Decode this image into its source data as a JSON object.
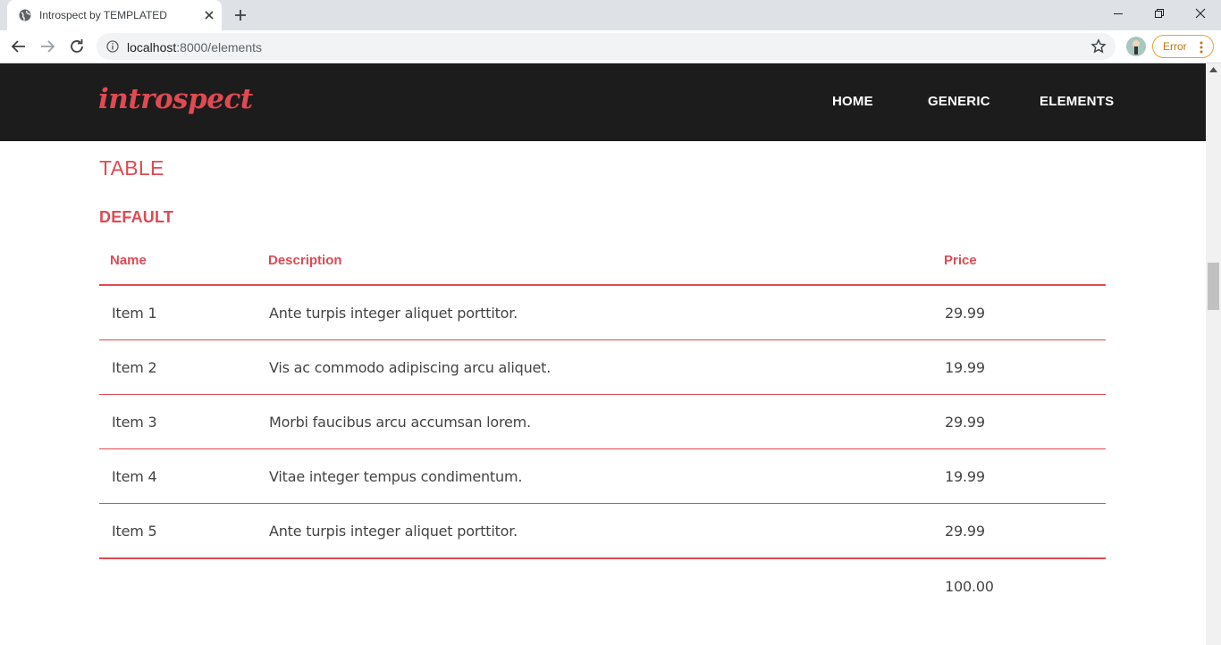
{
  "browser": {
    "tab_title": "Introspect by TEMPLATED",
    "url_host": "localhost",
    "url_rest": ":8000/elements",
    "profile_status": "Error"
  },
  "site": {
    "logo": "introspect",
    "nav": [
      "HOME",
      "GENERIC",
      "ELEMENTS"
    ],
    "accent_color": "#e04a52",
    "header_color": "#1c1c1c"
  },
  "section": {
    "heading": "TABLE",
    "subheading": "DEFAULT"
  },
  "table": {
    "columns": [
      "Name",
      "Description",
      "Price"
    ],
    "rows": [
      [
        "Item 1",
        "Ante turpis integer aliquet porttitor.",
        "29.99"
      ],
      [
        "Item 2",
        "Vis ac commodo adipiscing arcu aliquet.",
        "19.99"
      ],
      [
        "Item 3",
        "Morbi faucibus arcu accumsan lorem.",
        "29.99"
      ],
      [
        "Item 4",
        "Vitae integer tempus condimentum.",
        "19.99"
      ],
      [
        "Item 5",
        "Ante turpis integer aliquet porttitor.",
        "29.99"
      ]
    ],
    "total": "100.00"
  }
}
